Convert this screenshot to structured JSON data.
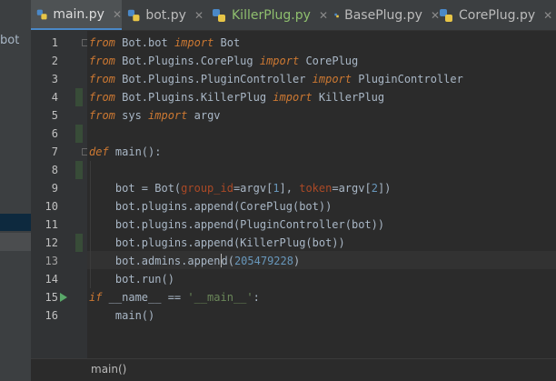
{
  "project_panel": {
    "fragment": "bot"
  },
  "tabs": [
    {
      "label": "main.py",
      "active": true,
      "color": "#dddddd"
    },
    {
      "label": "bot.py",
      "active": false,
      "color": "#bbbbbb"
    },
    {
      "label": "KillerPlug.py",
      "active": false,
      "color": "#8fbf6e"
    },
    {
      "label": "BasePlug.py",
      "active": false,
      "color": "#bbbbbb"
    },
    {
      "label": "CorePlug.py",
      "active": false,
      "color": "#bbbbbb"
    }
  ],
  "line_numbers": [
    "1",
    "2",
    "3",
    "4",
    "5",
    "6",
    "7",
    "8",
    "9",
    "10",
    "11",
    "12",
    "13",
    "14",
    "15",
    "16"
  ],
  "code": {
    "l1": {
      "kw1": "from",
      "mod": " Bot.bot ",
      "kw2": "import",
      "name": " Bot"
    },
    "l2": {
      "kw1": "from",
      "mod": " Bot.Plugins.CorePlug ",
      "kw2": "import",
      "name": " CorePlug"
    },
    "l3": {
      "kw1": "from",
      "mod": " Bot.Plugins.PluginController ",
      "kw2": "import",
      "name": " PluginController"
    },
    "l4": {
      "kw1": "from",
      "mod": " Bot.Plugins.KillerPlug ",
      "kw2": "import",
      "name": " KillerPlug"
    },
    "l5": {
      "kw1": "from",
      "mod": " sys ",
      "kw2": "import",
      "name": " argv"
    },
    "l7": {
      "kw": "def",
      "rest": " main():"
    },
    "l9": {
      "a": "    bot = Bot(",
      "p1": "group_id",
      "b": "=argv[",
      "n1": "1",
      "c": "], ",
      "p2": "token",
      "d": "=argv[",
      "n2": "2",
      "e": "])"
    },
    "l10": "    bot.plugins.append(CorePlug(bot))",
    "l11": "    bot.plugins.append(PluginController(bot))",
    "l12": "    bot.plugins.append(KillerPlug(bot))",
    "l13": {
      "a": "    bot.admins.appen",
      "b": "d(",
      "n": "205479228",
      "c": ")"
    },
    "l14": "    bot.run()",
    "l15": {
      "kw": "if",
      "a": " __name__ == ",
      "s": "'__main__'",
      "b": ":"
    },
    "l16": "    main()"
  },
  "breadcrumb": "main()",
  "icons": {
    "file": "python-file-icon",
    "run": "run-arrow-icon",
    "hint": "lightbulb-icon"
  },
  "colors": {
    "keyword": "#cc7832",
    "string": "#6a8759",
    "number": "#6897bb",
    "parameter": "#aa4926",
    "text": "#a9b7c6",
    "active_tab_underline": "#4a88c7"
  }
}
